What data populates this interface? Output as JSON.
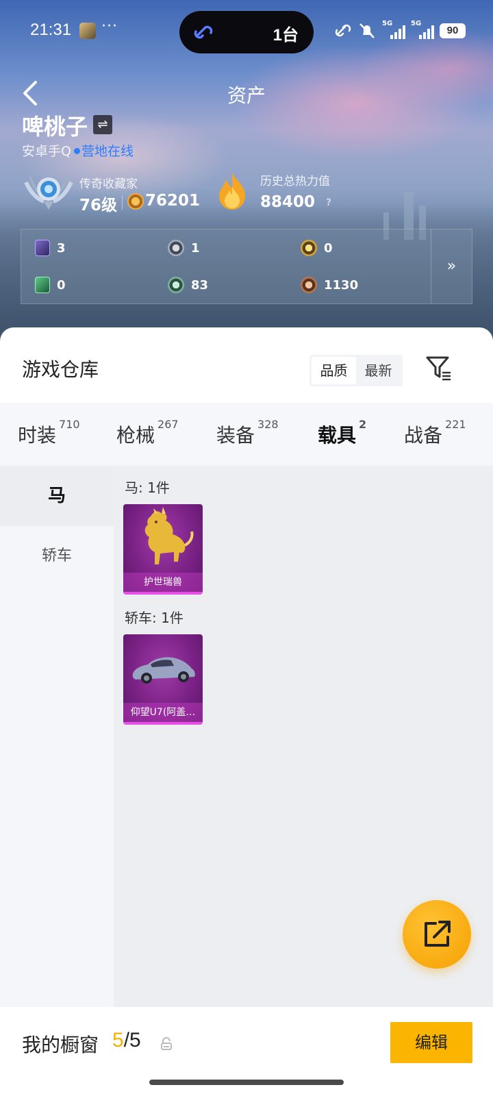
{
  "status_bar": {
    "time": "21:31",
    "dots": "···",
    "island_text": "1台",
    "network_1": "5G",
    "network_2": "5G",
    "battery": "90"
  },
  "header": {
    "title": "资产",
    "user_name": "啤桃子",
    "platform": "安卓手Q",
    "online_status": "营地在线",
    "rank_title": "传奇收藏家",
    "level": "76级",
    "coins": "76201",
    "heat_title": "历史总热力值",
    "heat_value": "88400",
    "help_glyph": "?"
  },
  "stats": {
    "items": [
      {
        "icon": "purple-card-icon",
        "value": "3"
      },
      {
        "icon": "silver-emblem-icon",
        "value": "1"
      },
      {
        "icon": "gold-emblem-icon",
        "value": "0"
      },
      {
        "icon": "green-card-icon",
        "value": "0"
      },
      {
        "icon": "jade-emblem-icon",
        "value": "83"
      },
      {
        "icon": "bronze-emblem-icon",
        "value": "1130"
      }
    ],
    "more_glyph": "»"
  },
  "warehouse": {
    "title": "游戏仓库",
    "sort_options": [
      "品质",
      "最新"
    ],
    "sort_selected": "品质"
  },
  "tabs": [
    {
      "label": "时装",
      "count": "710"
    },
    {
      "label": "枪械",
      "count": "267"
    },
    {
      "label": "装备",
      "count": "328"
    },
    {
      "label": "载具",
      "count": "2",
      "active": true
    },
    {
      "label": "战备",
      "count": "221"
    }
  ],
  "categories": [
    {
      "label": "马",
      "active": true
    },
    {
      "label": "轿车",
      "active": false
    }
  ],
  "groups": [
    {
      "label": "马: 1件",
      "items": [
        {
          "name": "护世瑞兽"
        }
      ]
    },
    {
      "label": "轿车: 1件",
      "items": [
        {
          "name": "仰望U7(阿盖…"
        }
      ]
    }
  ],
  "colors": {
    "accent": "#f5b000",
    "online": "#2d7dff",
    "rarity_purple": "#7b2286"
  },
  "showcase": {
    "label": "我的橱窗",
    "current": "5",
    "separator": "/",
    "total": "5",
    "edit_label": "编辑"
  }
}
